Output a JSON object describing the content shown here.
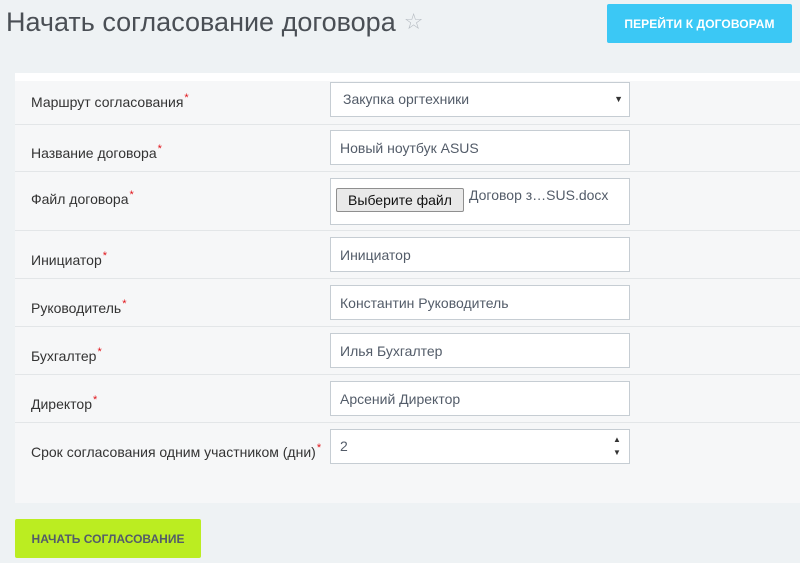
{
  "header": {
    "title": "Начать согласование договора",
    "star_icon": "☆",
    "goto_button_label": "Перейти к договорам"
  },
  "form": {
    "required_mark": "*",
    "route": {
      "label": "Маршрут согласования",
      "selected": "Закупка оргтехники",
      "chevron_icon": "▼"
    },
    "contract_name": {
      "label": "Название договора",
      "value": "Новый ноутбук ASUS"
    },
    "contract_file": {
      "label": "Файл договора",
      "button_label": "Выберите файл",
      "file_name": "Договор з…SUS.docx"
    },
    "initiator": {
      "label": "Инициатор",
      "value": "Инициатор"
    },
    "manager": {
      "label": "Руководитель",
      "value": "Константин Руководитель"
    },
    "accountant": {
      "label": "Бухгалтер",
      "value": "Илья Бухгалтер"
    },
    "director": {
      "label": "Директор",
      "value": "Арсений Директор"
    },
    "deadline": {
      "label": "Срок согласования одним участником (дни)",
      "value": "2",
      "up_icon": "▲",
      "down_icon": "▼"
    }
  },
  "actions": {
    "start_button_label": "Начать согласование"
  },
  "colors": {
    "accent_blue": "#3bc8f5",
    "accent_green": "#bbed21",
    "required": "#e0141a"
  }
}
